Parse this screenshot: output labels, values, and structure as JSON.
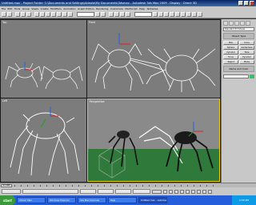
{
  "window": {
    "title": "Untitled.max - Project Folder: C:\\Documents and Settings\\Adeola\\My Documents\\3dsmax - Autodesk 3ds Max 2009 - Display : Direct 3D"
  },
  "menubar": {
    "items": [
      "File",
      "Edit",
      "Tools",
      "Group",
      "Views",
      "Create",
      "Modifiers",
      "Animation",
      "Graph Editors",
      "Rendering",
      "Customize",
      "MAXScript",
      "Help",
      "Tentacles"
    ]
  },
  "viewports": {
    "top": {
      "label": "Top"
    },
    "front": {
      "label": "Front"
    },
    "left": {
      "label": "Left"
    },
    "perspective": {
      "label": "Perspective"
    }
  },
  "command_panel": {
    "rollout_object_type": "Object Type",
    "rollout_name_color": "Name and Color",
    "buttons": [
      [
        "Box",
        "Cone"
      ],
      [
        "Sphere",
        "GeoSphere"
      ],
      [
        "Cylinder",
        "Tube"
      ],
      [
        "Torus",
        "Pyramid"
      ],
      [
        "Teapot",
        "Plane"
      ]
    ],
    "category": "Standard Primitives"
  },
  "timeline": {
    "frame_label": "0 / 100"
  },
  "taskbar": {
    "start_label": "start",
    "tasks": [
      "Yahoo! Mail",
      "Windows Explorer",
      "3ds Max tutorials",
      "Help",
      "Untitled.max - Autodesk 3..."
    ],
    "clock": "2:58 PM"
  },
  "colors": {
    "viewport_bg": "#7c7c7c",
    "active_viewport_border": "#f0d000",
    "ground_green": "#2f7a3a",
    "wire_white": "#ffffff"
  }
}
